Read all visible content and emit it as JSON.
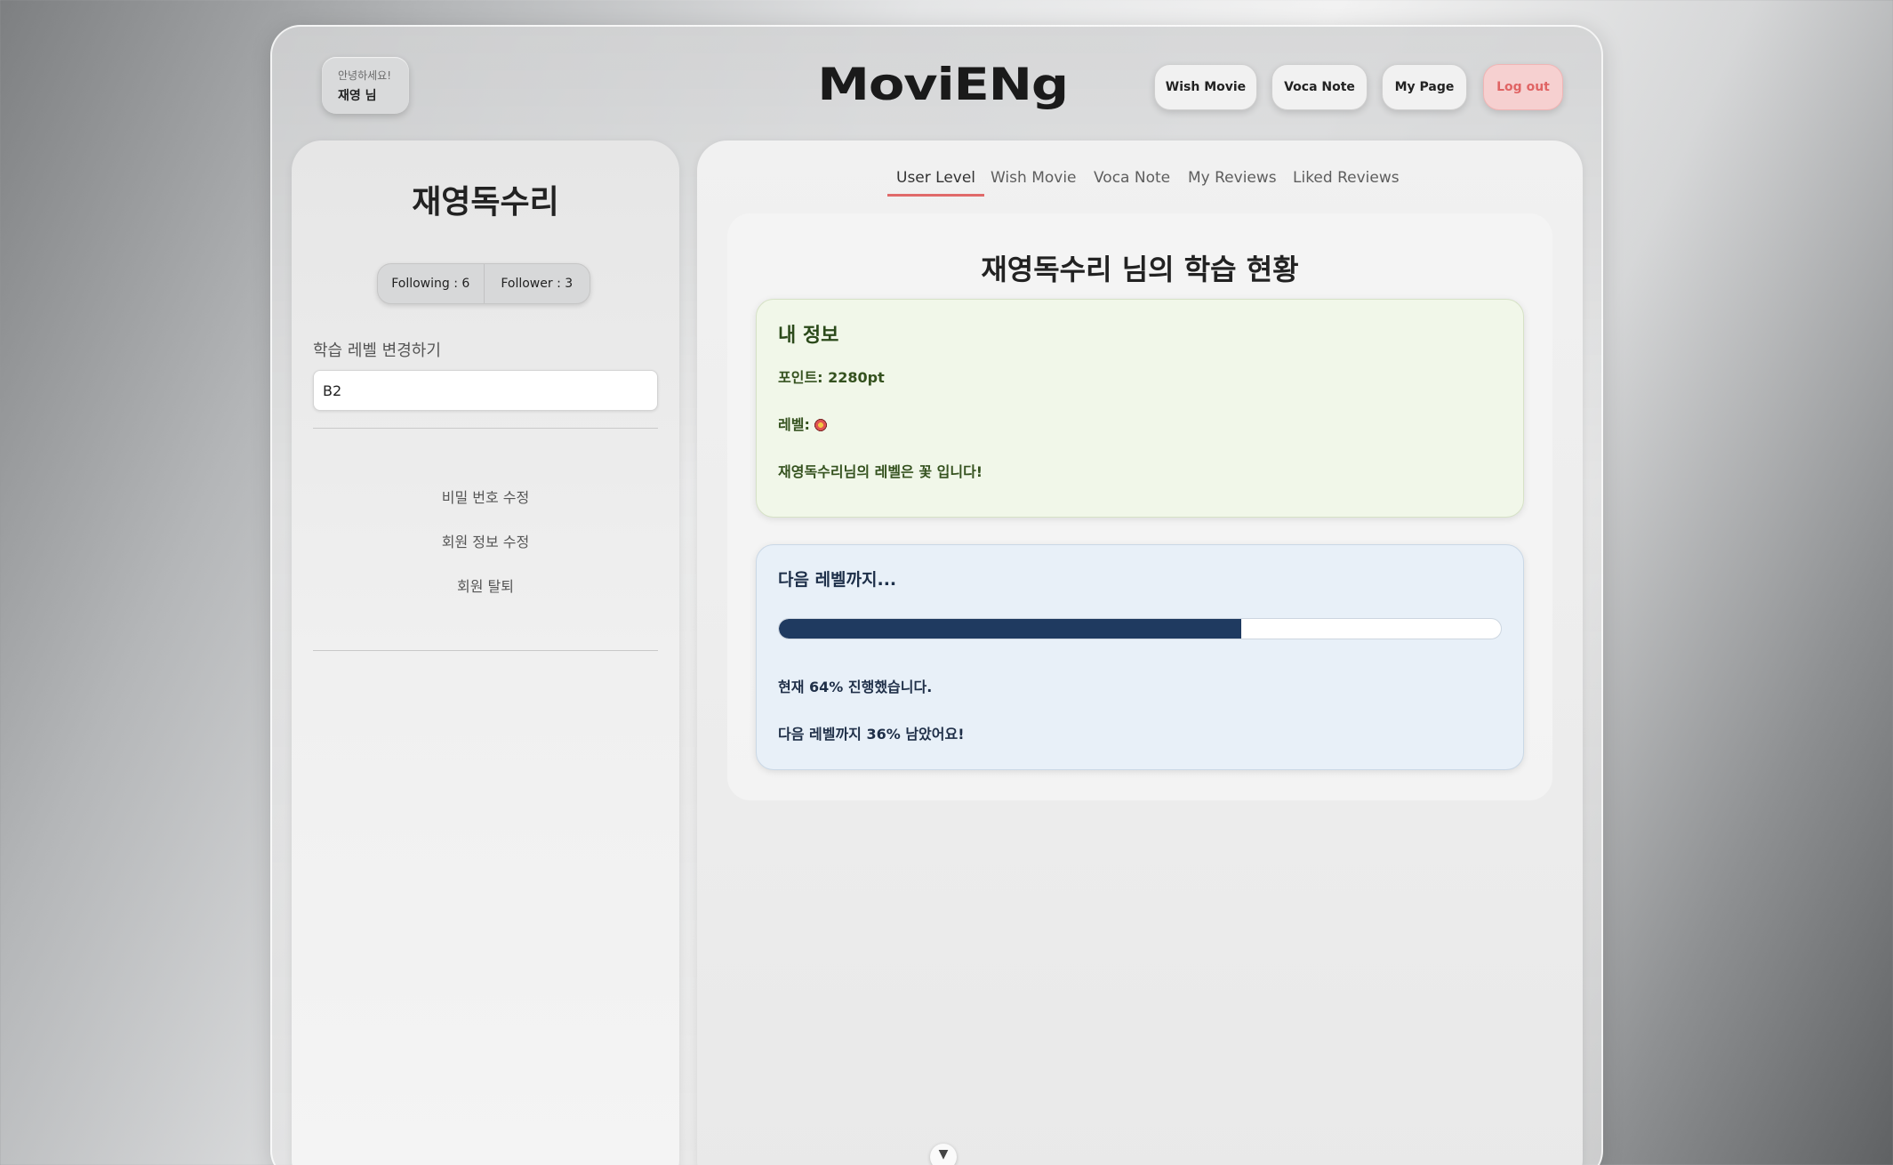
{
  "header": {
    "greeting": "안녕하세요!",
    "user_name": "재영 님",
    "logo": "MoviENg",
    "nav": {
      "wish_movie": "Wish Movie",
      "voca_note": "Voca Note",
      "my_page": "My Page",
      "logout": "Log out"
    }
  },
  "sidebar": {
    "nickname": "재영독수리",
    "following": "Following : 6",
    "follower": "Follower : 3",
    "level_change_label": "학습 레벨 변경하기",
    "level_value": "B2",
    "links": {
      "change_password": "비밀 번호 수정",
      "edit_profile": "회원 정보 수정",
      "withdraw": "회원 탈퇴"
    }
  },
  "tabs": {
    "user_level": "User Level",
    "wish_movie": "Wish Movie",
    "voca_note": "Voca Note",
    "my_reviews": "My Reviews",
    "liked_reviews": "Liked Reviews",
    "active": "user_level"
  },
  "main": {
    "heading": "재영독수리 님의 학습 현황",
    "info_card": {
      "title": "내 정보",
      "points": "포인트: 2280pt",
      "level_label": "레벨:",
      "level_icon": "flower-icon",
      "level_message": "재영독수리님의 레벨은 꽃 입니다!"
    },
    "progress_card": {
      "title": "다음 레벨까지...",
      "progress_percent": 64,
      "current_text": "현재 64% 진행했습니다.",
      "remaining_text": "다음 레벨까지 36% 남았어요!"
    }
  },
  "colors": {
    "logout_bg": "#f6d0d0",
    "logout_text": "#e06464",
    "active_tab_underline": "#e06a6a",
    "progress_fill": "#1f3a60",
    "info_card_bg": "#f1f7e9",
    "progress_card_bg": "#e8f0f8"
  }
}
